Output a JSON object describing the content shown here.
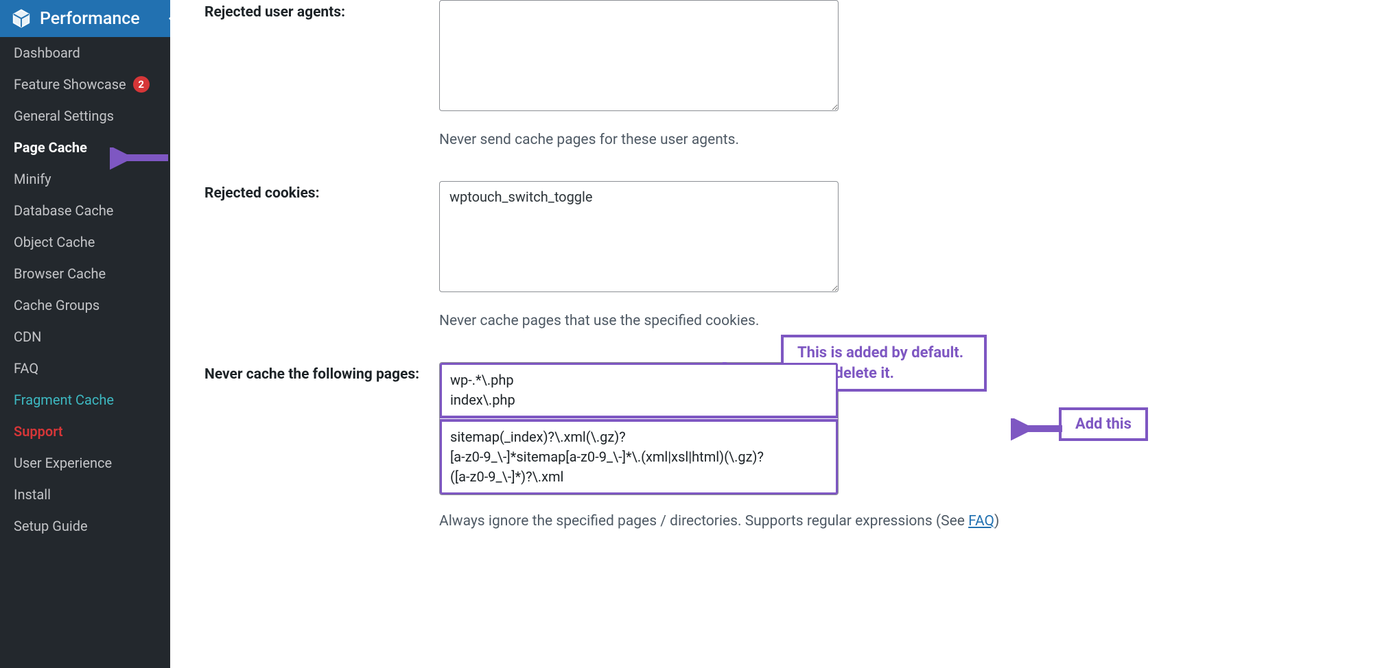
{
  "sidebar": {
    "header": "Performance",
    "items": [
      {
        "label": "Dashboard"
      },
      {
        "label": "Feature Showcase",
        "badge": "2"
      },
      {
        "label": "General Settings"
      },
      {
        "label": "Page Cache",
        "active": true
      },
      {
        "label": "Minify"
      },
      {
        "label": "Database Cache"
      },
      {
        "label": "Object Cache"
      },
      {
        "label": "Browser Cache"
      },
      {
        "label": "Cache Groups"
      },
      {
        "label": "CDN"
      },
      {
        "label": "FAQ"
      },
      {
        "label": "Fragment Cache",
        "teal": true
      },
      {
        "label": "Support",
        "red": true
      },
      {
        "label": "User Experience"
      },
      {
        "label": "Install"
      },
      {
        "label": "Setup Guide"
      }
    ]
  },
  "fields": {
    "rejected_ua": {
      "label": "Rejected user agents:",
      "value": "",
      "help": "Never send cache pages for these user agents."
    },
    "rejected_cookies": {
      "label": "Rejected cookies:",
      "value": "wptouch_switch_toggle",
      "help": "Never cache pages that use the specified cookies."
    },
    "never_cache": {
      "label": "Never cache the following pages:",
      "top_lines": "wp-.*\\.php\nindex\\.php",
      "bottom_lines": "sitemap(_index)?\\.xml(\\.gz)?\n[a-z0-9_\\-]*sitemap[a-z0-9_\\-]*\\.(xml|xsl|html)(\\.gz)?\n([a-z0-9_\\-]*)?\\.xml",
      "help_pre": "Always ignore the specified pages / directories. Supports regular expressions (See ",
      "help_link": "FAQ",
      "help_post": ")"
    }
  },
  "annotations": {
    "top": "This is added by default. Don't delete it.",
    "bottom": "Add this"
  }
}
